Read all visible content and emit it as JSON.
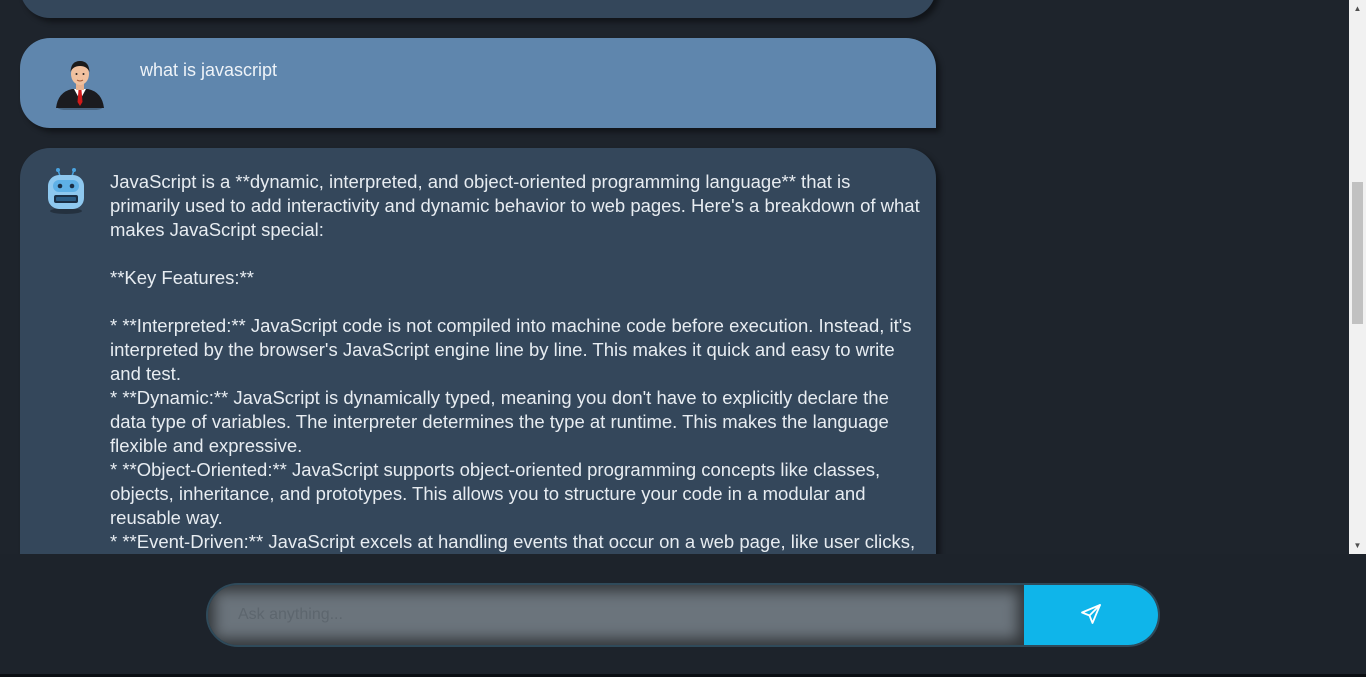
{
  "chat": {
    "user_message": "what is javascript",
    "bot_message": "JavaScript is a **dynamic, interpreted, and object-oriented programming language** that is primarily used to add interactivity and dynamic behavior to web pages. Here's a breakdown of what makes JavaScript special:\n\n**Key Features:**\n\n* **Interpreted:** JavaScript code is not compiled into machine code before execution. Instead, it's interpreted by the browser's JavaScript engine line by line. This makes it quick and easy to write and test.\n* **Dynamic:** JavaScript is dynamically typed, meaning you don't have to explicitly declare the data type of variables. The interpreter determines the type at runtime. This makes the language flexible and expressive.\n* **Object-Oriented:** JavaScript supports object-oriented programming concepts like classes, objects, inheritance, and prototypes. This allows you to structure your code in a modular and reusable way.\n* **Event-Driven:** JavaScript excels at handling events that occur on a web page, like user clicks,"
  },
  "input": {
    "placeholder": "Ask anything...",
    "value": ""
  },
  "icons": {
    "user_avatar": "user-avatar-icon",
    "bot_avatar": "robot-icon",
    "send": "paper-plane-icon"
  },
  "colors": {
    "user_bubble": "#5f86ad",
    "bot_bubble": "#34475b",
    "send_button": "#0fb5ea",
    "background": "#1e242c"
  }
}
